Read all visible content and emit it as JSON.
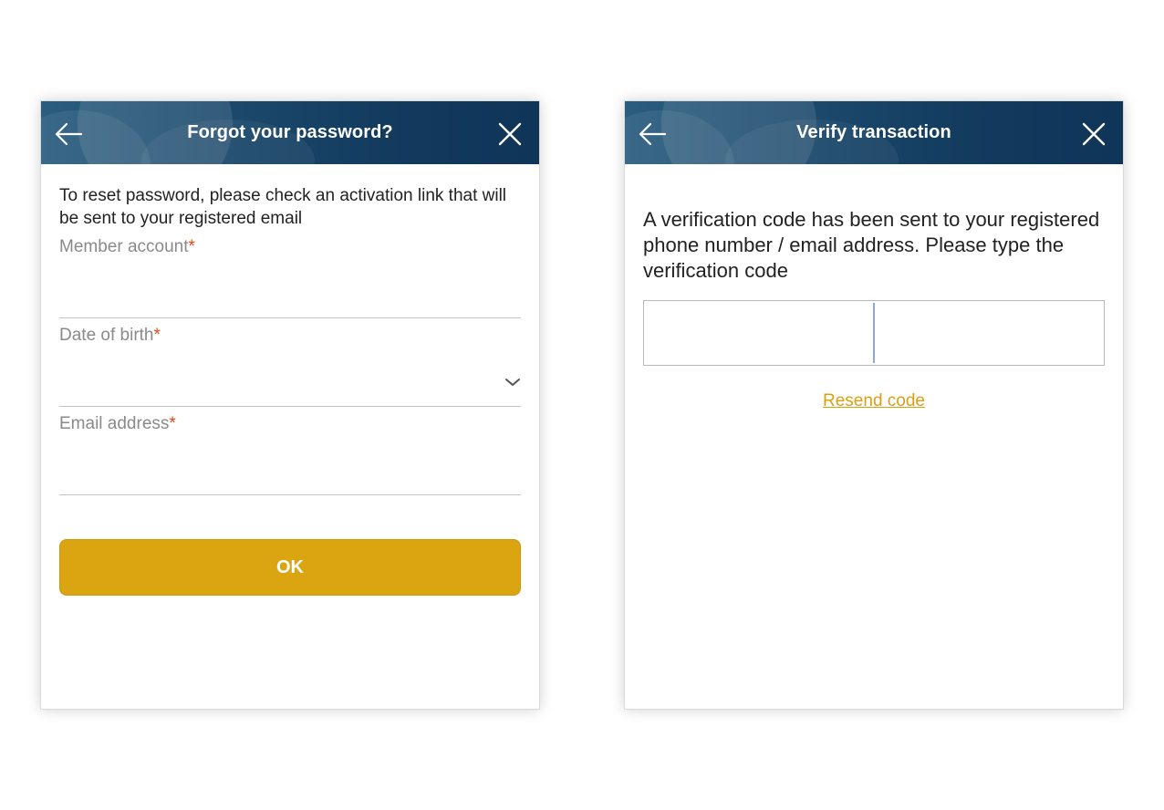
{
  "forgot_password": {
    "title": "Forgot your password?",
    "back_icon": "arrow-left-icon",
    "close_icon": "close-icon",
    "intro_text": "To reset password, please check an activation link that will be sent to your registered email",
    "fields": [
      {
        "label": "Member account",
        "required_mark": "*",
        "value": ""
      },
      {
        "label": "Date of birth",
        "required_mark": "*",
        "value": "",
        "icon": "chevron-down-icon"
      },
      {
        "label": "Email address",
        "required_mark": "*",
        "value": ""
      }
    ],
    "ok_label": "OK"
  },
  "verify_transaction": {
    "title": "Verify transaction",
    "back_icon": "arrow-left-icon",
    "close_icon": "close-icon",
    "message": "A verification code has been sent to your registered phone number / email address. Please type the verification code",
    "code_value": "",
    "resend_label": "Resend code"
  },
  "colors": {
    "header_gradient_start": "#2a5d80",
    "header_gradient_end": "#0f3559",
    "accent_gold": "#dba411",
    "required_red": "#e04a14",
    "label_gray": "#8a8a8a",
    "cursor_blue": "#8aa6e6"
  }
}
